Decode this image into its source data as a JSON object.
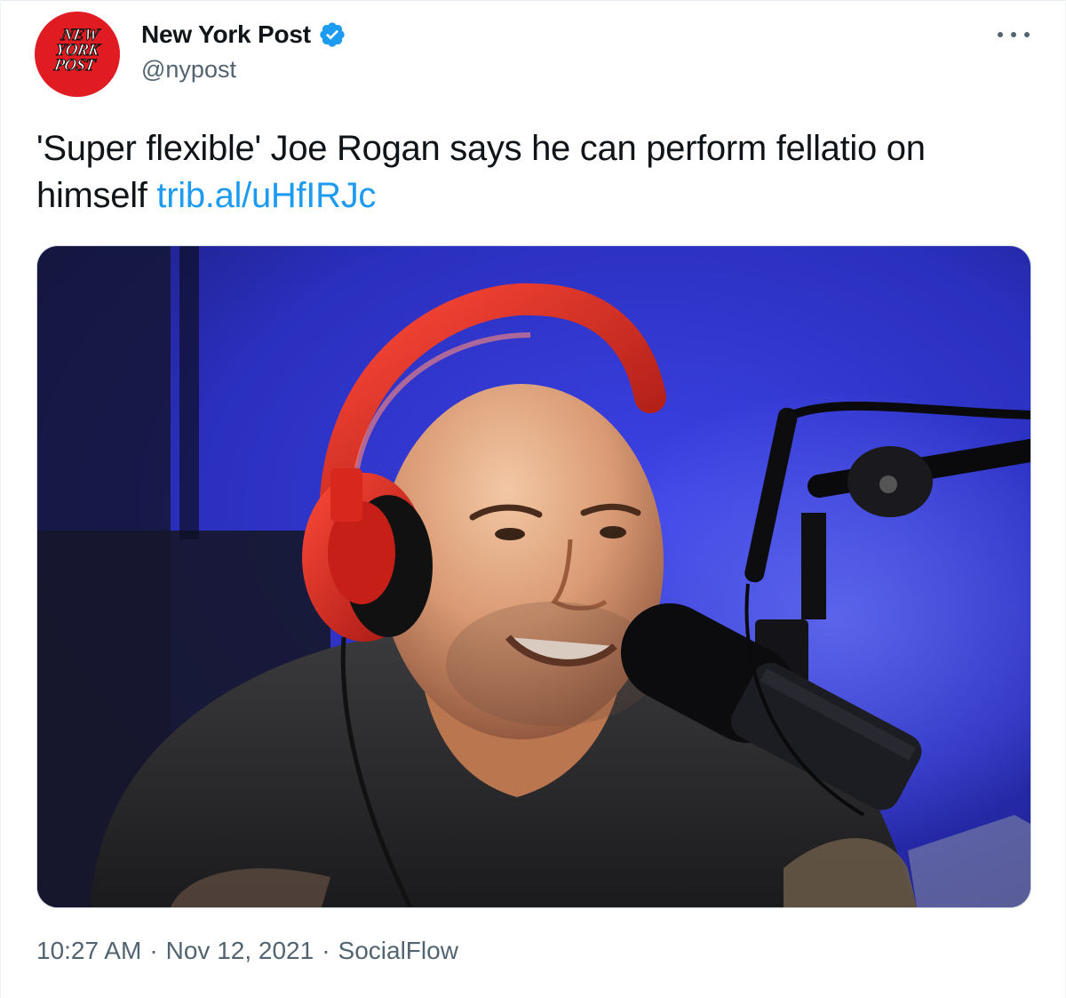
{
  "author": {
    "display_name": "New York Post",
    "handle": "@nypost",
    "verified": true,
    "avatar_logo_lines": [
      "NEW",
      "YORK",
      "POST"
    ],
    "avatar_color": "#e11b22"
  },
  "tweet": {
    "text": "'Super flexible' Joe Rogan says he can perform fellatio on himself ",
    "link": "trib.al/uHfIRJc",
    "link_color": "#1d9bf0"
  },
  "media": {
    "icon": "photo-podcast-studio"
  },
  "footer": {
    "time": "10:27 AM",
    "separator": "·",
    "date": "Nov 12, 2021",
    "source": "SocialFlow"
  },
  "icons": {
    "verified": "verified-badge-icon",
    "more": "more-options-icon"
  }
}
